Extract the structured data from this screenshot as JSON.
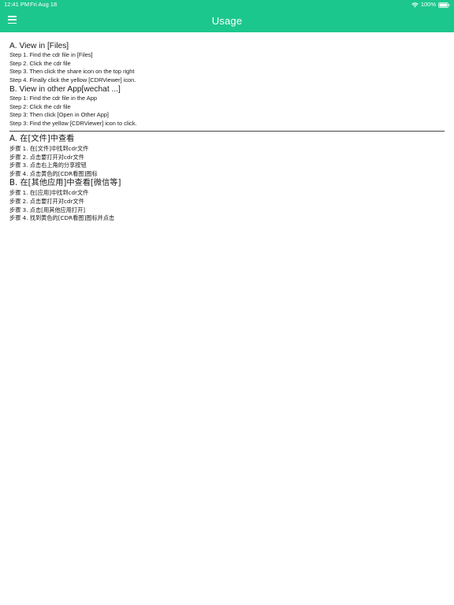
{
  "status_bar": {
    "time": "12:41 PM",
    "date": "Fri Aug 18",
    "battery": "100%"
  },
  "nav": {
    "title": "Usage",
    "menu_icon": "hamburger-menu-icon"
  },
  "colors": {
    "accent": "#1cc78d",
    "text": "#1a1a1a",
    "background": "#ffffff"
  },
  "english": {
    "section_a": {
      "heading": "A. View in [Files]",
      "steps": [
        "Step 1. Find the cdr file in [Files]",
        "Step 2. Click the cdr file",
        "Step 3. Then click the share icon on the top right",
        "Step 4. Finally click the yellow [CDRViewer] icon."
      ]
    },
    "section_b": {
      "heading": "B. View in other App[wechat ...]",
      "steps": [
        "Step 1: Find the cdr file in the App",
        "Step 2: Click the cdr file",
        "Step 3: Then click [Open in Other App]",
        "Step 3: Find the yellow [CDRViewer] icon to click."
      ]
    }
  },
  "chinese": {
    "section_a": {
      "heading": "A. 在[文件]中查看",
      "steps": [
        "步骤 1. 在[文件]中找到cdr文件",
        "步骤 2. 点击要打开对cdr文件",
        "步骤 3. 点击右上角的分享按钮",
        "步骤 4. 点击黄色的[CDR看图]图标"
      ]
    },
    "section_b": {
      "heading": "B. 在[其他应用]中查看[微信等]",
      "steps": [
        "步骤 1. 在[应用]中找到cdr文件",
        "步骤 2. 点击要打开对cdr文件",
        "步骤 3. 点击[用其他应用打开]",
        "步骤 4. 找到黄色的[CDR看图]图标并点击"
      ]
    }
  }
}
